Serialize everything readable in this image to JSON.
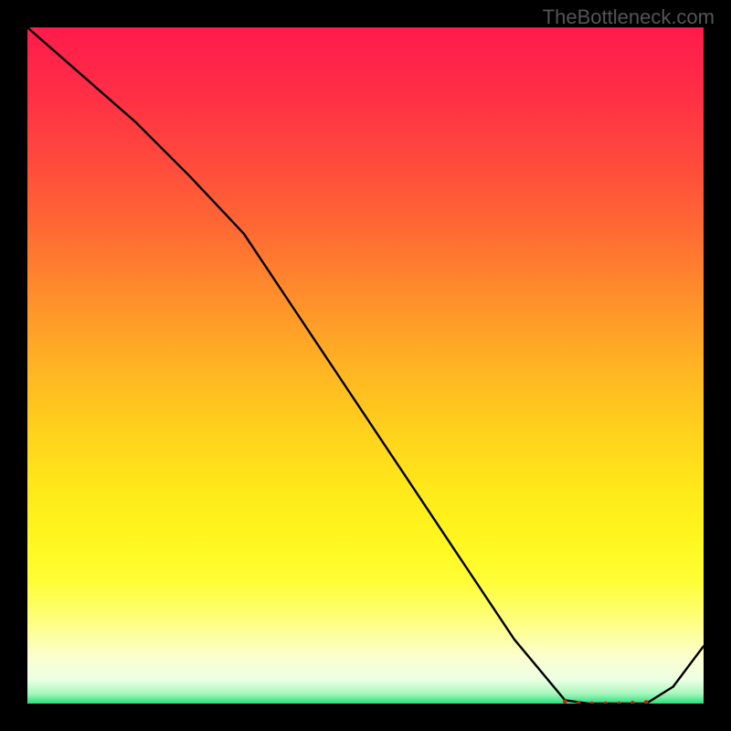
{
  "attribution": "TheBottleneck.com",
  "colors": {
    "curve_stroke": "#000000",
    "marker_fill": "#c8240d",
    "marker_text": "#b51e0a"
  },
  "gradient_stops": [
    {
      "offset": 0.0,
      "color": "#ff1b4c"
    },
    {
      "offset": 0.1,
      "color": "#ff2f45"
    },
    {
      "offset": 0.2,
      "color": "#ff4a3c"
    },
    {
      "offset": 0.3,
      "color": "#ff6a33"
    },
    {
      "offset": 0.4,
      "color": "#ff8f2b"
    },
    {
      "offset": 0.5,
      "color": "#ffb323"
    },
    {
      "offset": 0.6,
      "color": "#ffd21c"
    },
    {
      "offset": 0.68,
      "color": "#ffe81a"
    },
    {
      "offset": 0.76,
      "color": "#fff71e"
    },
    {
      "offset": 0.82,
      "color": "#fffd36"
    },
    {
      "offset": 0.88,
      "color": "#feff82"
    },
    {
      "offset": 0.93,
      "color": "#fbffce"
    },
    {
      "offset": 0.965,
      "color": "#ecffe3"
    },
    {
      "offset": 0.985,
      "color": "#a9f7bd"
    },
    {
      "offset": 1.0,
      "color": "#26e07a"
    }
  ],
  "chart_data": {
    "type": "line",
    "title": "",
    "xlabel": "",
    "ylabel": "",
    "xlim": [
      0,
      1
    ],
    "ylim": [
      0,
      1
    ],
    "x": [
      0.0,
      0.08,
      0.16,
      0.24,
      0.32,
      0.4,
      0.48,
      0.56,
      0.64,
      0.72,
      0.795,
      0.83,
      0.875,
      0.915,
      0.955,
      1.0
    ],
    "values": [
      1.0,
      0.93,
      0.86,
      0.78,
      0.695,
      0.575,
      0.455,
      0.335,
      0.215,
      0.095,
      0.005,
      0.0,
      0.0,
      0.0,
      0.025,
      0.085
    ],
    "marker": {
      "label": "",
      "x_range": [
        0.795,
        0.915
      ],
      "dots_x": [
        0.795,
        0.815,
        0.835,
        0.855,
        0.875,
        0.895,
        0.915
      ],
      "dots_y": [
        0.003,
        0.001,
        0.0,
        0.0,
        0.0,
        0.001,
        0.002
      ]
    }
  }
}
